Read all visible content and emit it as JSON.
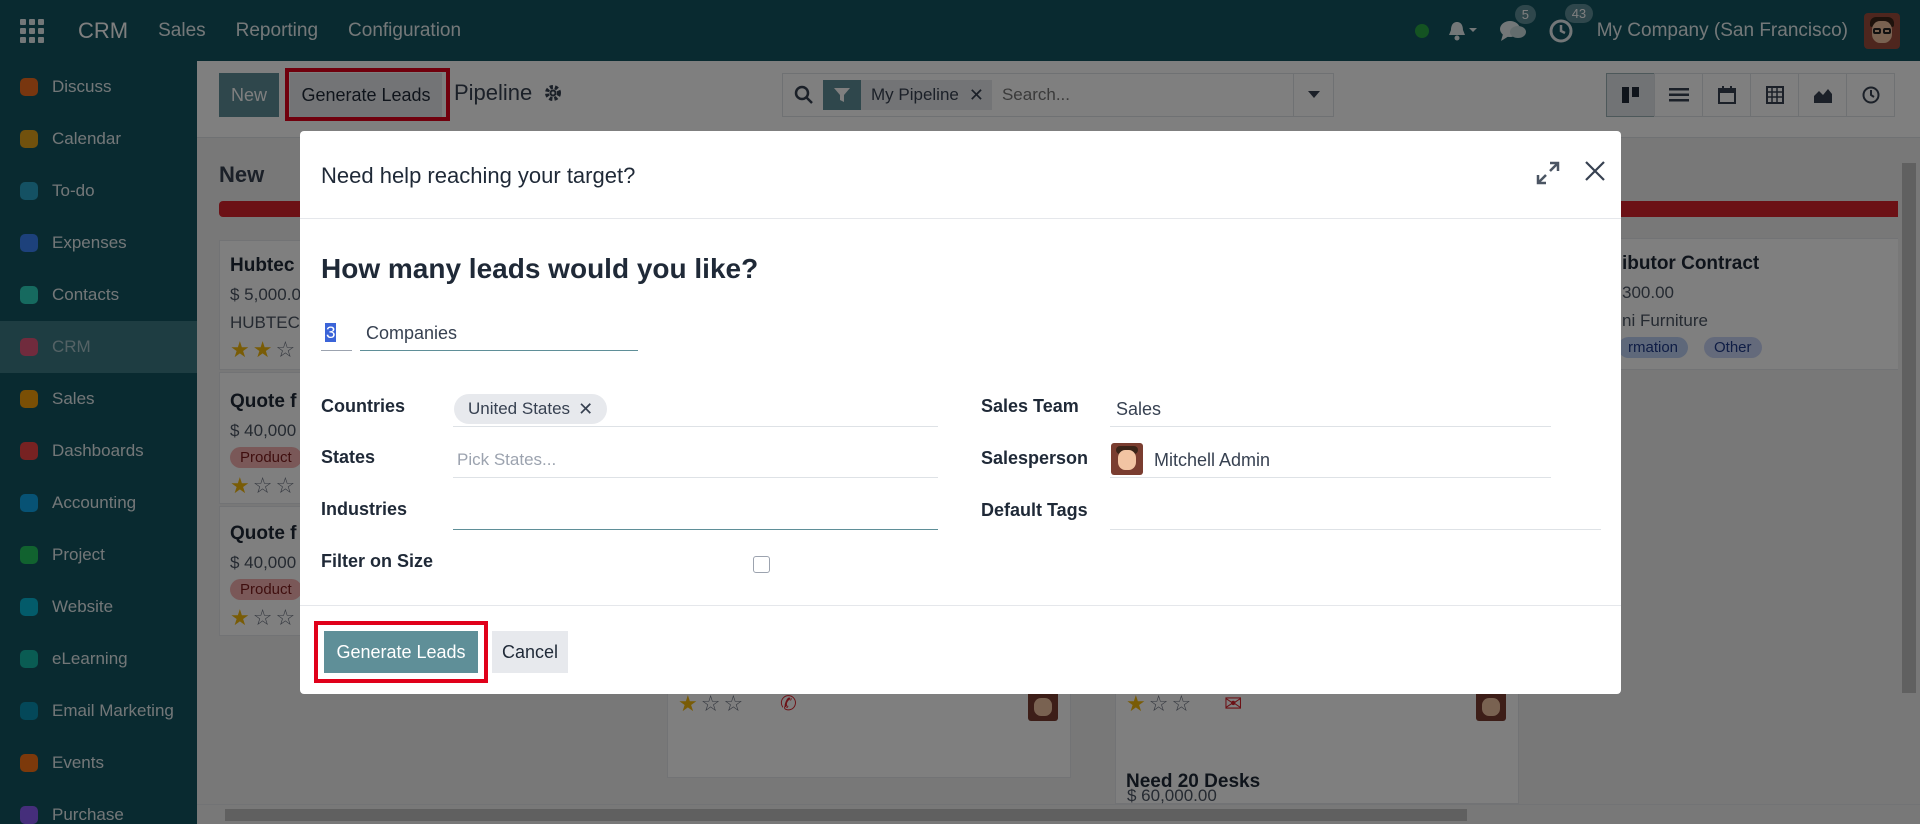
{
  "topbar": {
    "brand": "CRM",
    "menu": [
      "Sales",
      "Reporting",
      "Configuration"
    ],
    "messages_count": "5",
    "activities_count": "43",
    "company": "My Company (San Francisco)"
  },
  "sidebar": {
    "items": [
      {
        "label": "Discuss",
        "icon": "discuss-icon",
        "color": "#f06d1e"
      },
      {
        "label": "Calendar",
        "icon": "calendar-icon",
        "color": "#e3a21a"
      },
      {
        "label": "To-do",
        "icon": "todo-icon",
        "color": "#29a3c6"
      },
      {
        "label": "Expenses",
        "icon": "expenses-icon",
        "color": "#3b82f6"
      },
      {
        "label": "Contacts",
        "icon": "contacts-icon",
        "color": "#2dd4bf"
      },
      {
        "label": "CRM",
        "icon": "crm-icon",
        "color": "#e0567a"
      },
      {
        "label": "Sales",
        "icon": "sales-icon",
        "color": "#f59e0b"
      },
      {
        "label": "Dashboards",
        "icon": "dashboards-icon",
        "color": "#ef4444"
      },
      {
        "label": "Accounting",
        "icon": "accounting-icon",
        "color": "#0ea5e9"
      },
      {
        "label": "Project",
        "icon": "project-icon",
        "color": "#22c55e"
      },
      {
        "label": "Website",
        "icon": "website-icon",
        "color": "#06b6d4"
      },
      {
        "label": "eLearning",
        "icon": "elearning-icon",
        "color": "#14b8a6"
      },
      {
        "label": "Email Marketing",
        "icon": "email-marketing-icon",
        "color": "#0891b2"
      },
      {
        "label": "Events",
        "icon": "events-icon",
        "color": "#f97316"
      },
      {
        "label": "Purchase",
        "icon": "purchase-icon",
        "color": "#8b5cf6"
      }
    ],
    "active_index": 5
  },
  "control": {
    "new_label": "New",
    "generate_label": "Generate Leads",
    "title": "Pipeline",
    "facet": "My Pipeline",
    "search_placeholder": "Search..."
  },
  "kanban": {
    "col1_title": "New",
    "cards_left": [
      {
        "title": "Hubtec",
        "amount": "$ 5,000.0",
        "company": "HUBTEC"
      },
      {
        "title": "Quote f",
        "amount": "$ 40,000",
        "tag": "Product"
      },
      {
        "title": "Quote f",
        "amount": "$ 40,000",
        "tag": "Product"
      }
    ],
    "card_right": {
      "title": "ibutor Contract",
      "amount": "300.00",
      "company": "ni Furniture",
      "tag1": "rmation",
      "tag2": "Other"
    },
    "card_bottom": {
      "title": "Need 20 Desks",
      "amount": "$ 60,000.00"
    },
    "colors": {
      "bar": "#d9232d",
      "star": "#f3b80c",
      "tag_product": "#f4b0b0",
      "tag_info": "#bcd0f5",
      "tag_other": "#c9d4f7"
    }
  },
  "modal": {
    "title": "Need help reaching your target?",
    "question": "How many leads would you like?",
    "quantity": "3",
    "unit": "Companies",
    "countries_label": "Countries",
    "country_chip": "United States",
    "states_label": "States",
    "states_placeholder": "Pick States...",
    "industries_label": "Industries",
    "filter_size_label": "Filter on Size",
    "sales_team_label": "Sales Team",
    "sales_team_value": "Sales",
    "salesperson_label": "Salesperson",
    "salesperson_value": "Mitchell Admin",
    "default_tags_label": "Default Tags",
    "generate_label": "Generate Leads",
    "cancel_label": "Cancel"
  }
}
